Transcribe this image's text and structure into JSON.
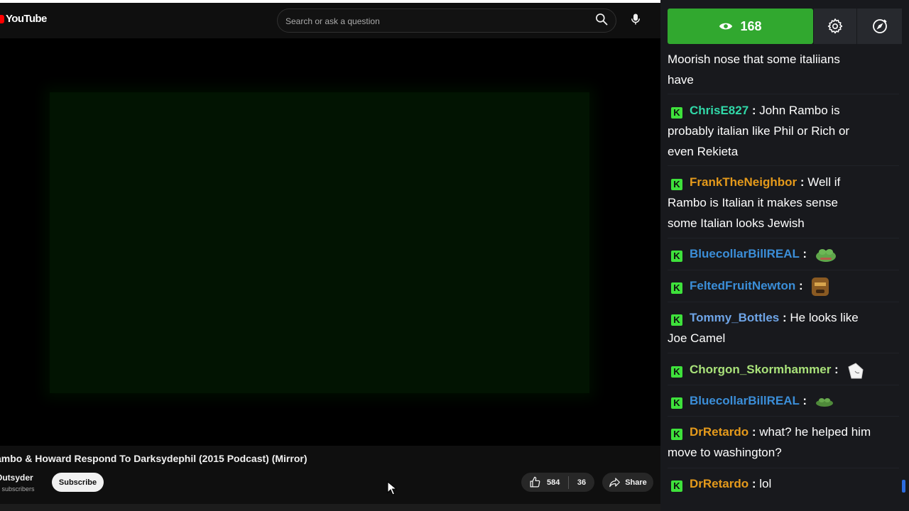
{
  "youtube": {
    "logo_text": "YouTube",
    "search": {
      "placeholder": "Search or ask a question"
    },
    "video": {
      "title": "ambo & Howard Respond To Darksydephil (2015 Podcast) (Mirror)",
      "channel_name": "Outsyder",
      "channel_subscribers": "K subscribers",
      "subscribe_label": "Subscribe",
      "likes": "584",
      "dislikes": "36",
      "share_label": "Share"
    }
  },
  "chat": {
    "viewer_count": "168",
    "colors": {
      "viewer_bar": "#31a82f",
      "badge": "#3ee13b"
    },
    "messages": [
      {
        "lines": [
          "Moorish nose that some italiians",
          "have"
        ]
      },
      {
        "user": "ChrisE827",
        "user_color": "#31d8a8",
        "lines": [
          "John Rambo is",
          "probably italian like Phil or Rich or",
          "even Rekieta"
        ]
      },
      {
        "user": "FrankTheNeighbor",
        "user_color": "#e59a1b",
        "lines": [
          "Well if",
          "Rambo is Italian it makes sense",
          "some Italian looks Jewish"
        ]
      },
      {
        "user": "BluecollarBillREAL",
        "user_color": "#3b8ed8",
        "emote": "pepe-frog-emote"
      },
      {
        "user": "FeltedFruitNewton",
        "user_color": "#3b8ed8",
        "emote": "face-emote"
      },
      {
        "user": "Tommy_Bottles",
        "user_color": "#6ea4e6",
        "lines": [
          "He looks like",
          "Joe Camel"
        ]
      },
      {
        "user": "Chorgon_Skormhammer",
        "user_color": "#a9e27a",
        "emote": "hand-emote"
      },
      {
        "user": "BluecollarBillREAL",
        "user_color": "#3b8ed8",
        "emote": "pepe-small-emote"
      },
      {
        "user": "DrRetardo",
        "user_color": "#e59a1b",
        "lines": [
          "what? he helped him",
          "move to washington?"
        ]
      },
      {
        "user": "DrRetardo",
        "user_color": "#e59a1b",
        "lines": [
          "lol"
        ]
      }
    ]
  }
}
